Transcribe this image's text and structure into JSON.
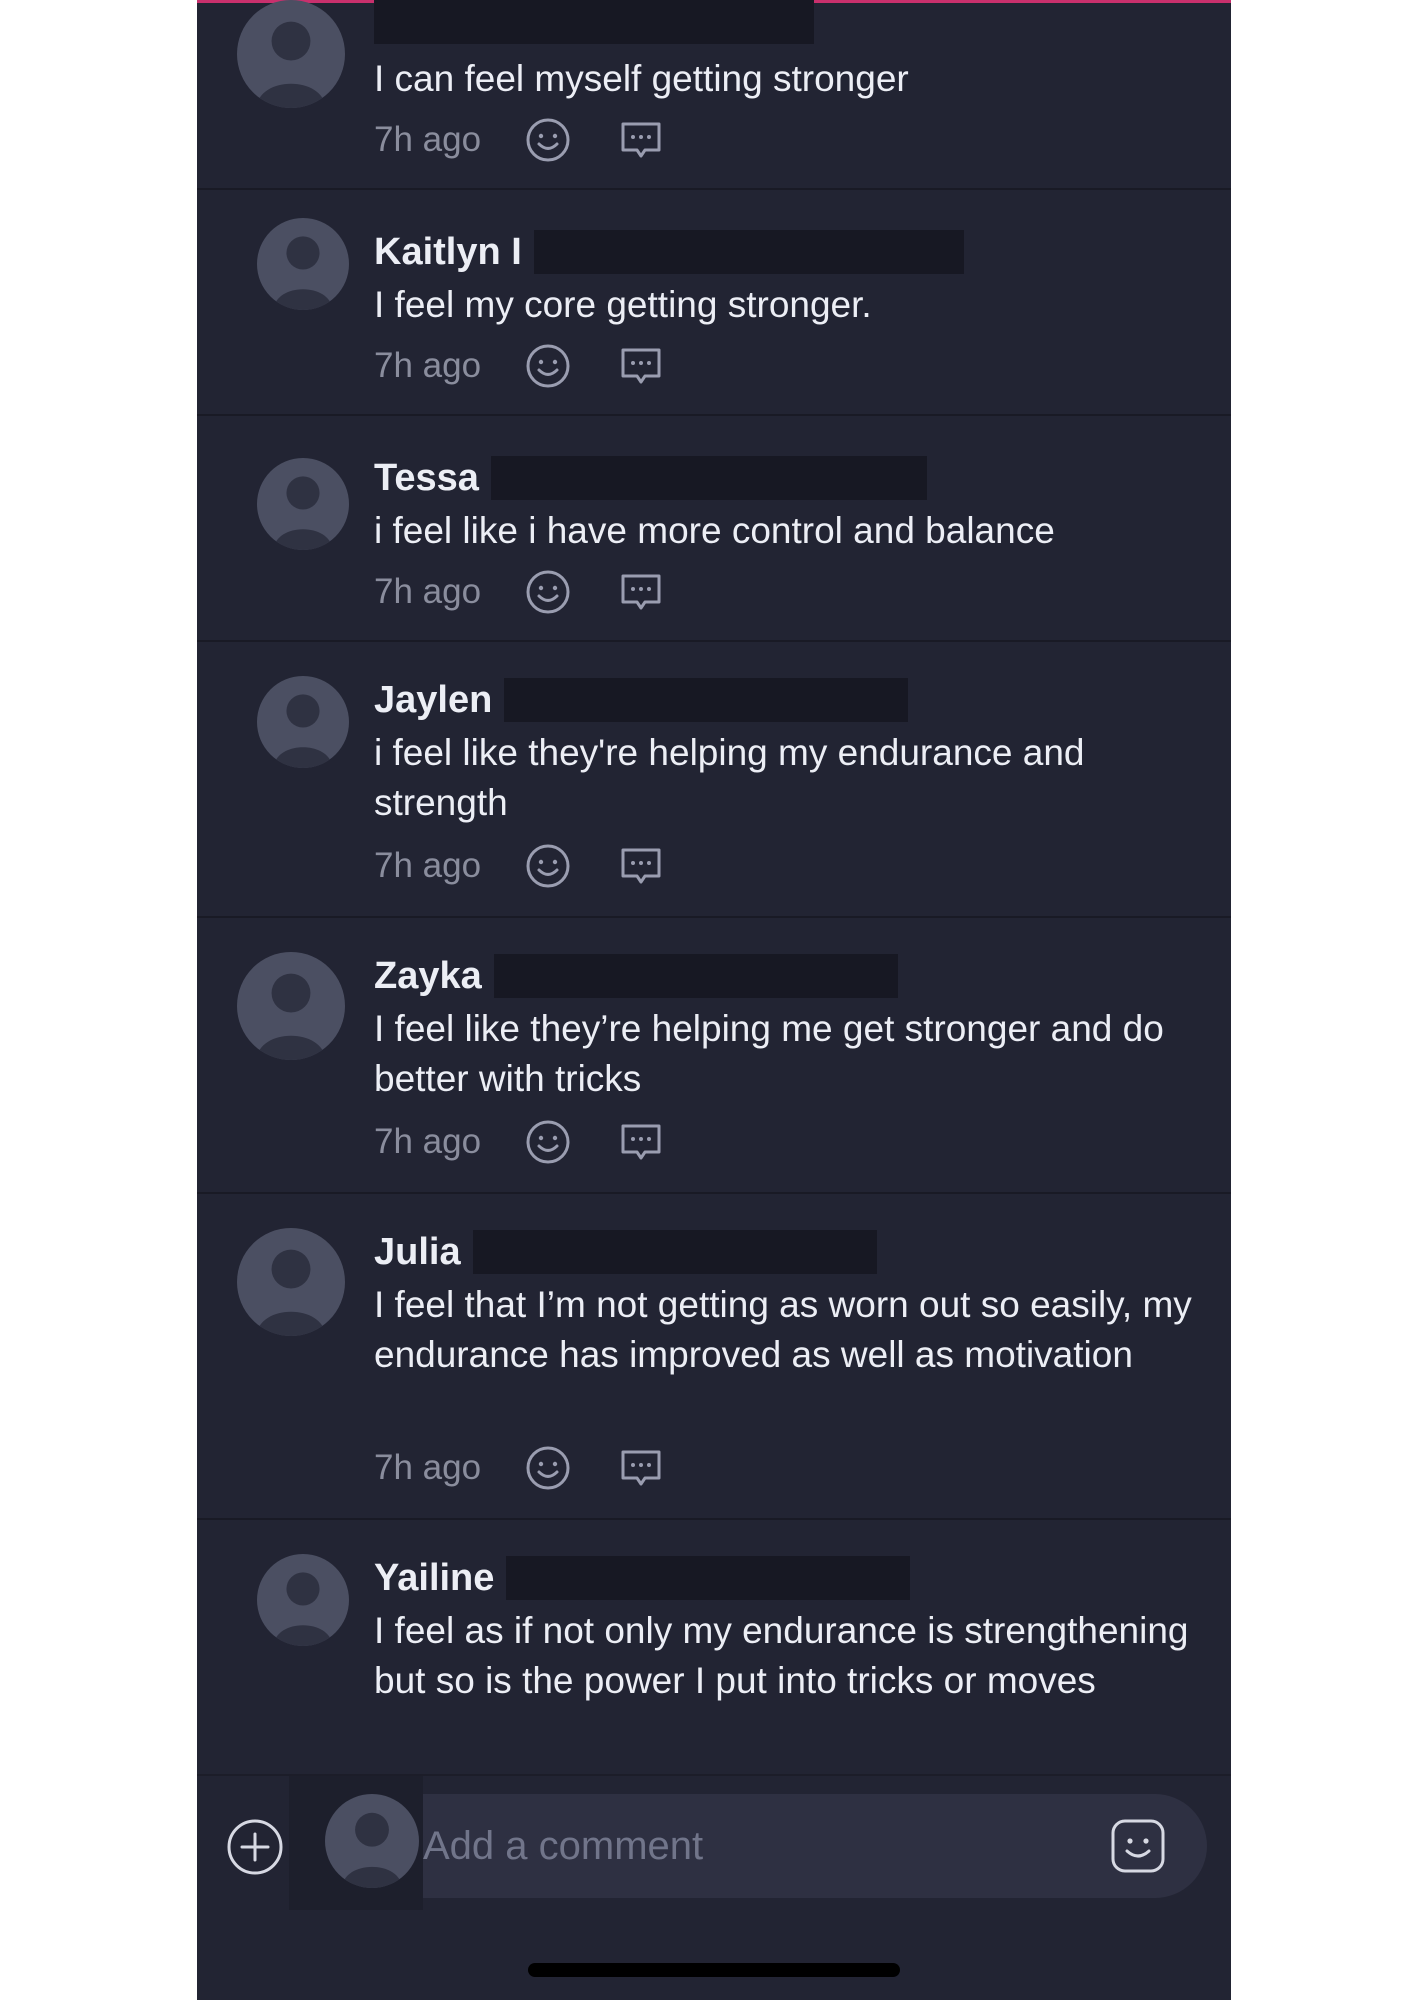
{
  "comments": [
    {
      "author": "",
      "text": "I can feel myself getting stronger",
      "time": "7h ago",
      "avatar_icon": "default-avatar-icon"
    },
    {
      "author": "Kaitlyn I",
      "text": "I feel my core getting stronger.",
      "time": "7h ago",
      "avatar_icon": "default-avatar-icon"
    },
    {
      "author": "Tessa",
      "text": "i feel like i have more control and balance",
      "time": "7h ago",
      "avatar_icon": "default-avatar-icon"
    },
    {
      "author": "Jaylen",
      "text": "i feel like they're helping my endurance and strength",
      "time": "7h ago",
      "avatar_icon": "default-avatar-icon"
    },
    {
      "author": "Zayka",
      "text": "I feel like they’re helping me get stronger and do better with tricks",
      "time": "7h ago",
      "avatar_icon": "default-avatar-icon"
    },
    {
      "author": "Julia",
      "text": "I feel that I’m not getting as worn out so easily, my endurance has improved as well as motivation",
      "time": "7h ago",
      "avatar_icon": "default-avatar-icon"
    },
    {
      "author": "Yailine",
      "text": "I feel as if not only my endurance is strengthening but so is the power I put into tricks or moves",
      "time": "",
      "avatar_icon": "default-avatar-icon"
    }
  ],
  "comment_actions": {
    "react_icon": "smiley-icon",
    "reply_icon": "speech-bubble-icon"
  },
  "composer": {
    "placeholder": "Add a comment",
    "add_icon": "plus-circle-icon",
    "emoji_icon": "emoji-icon"
  },
  "colors": {
    "background": "#222433",
    "accent": "#c9306d",
    "text": "#eceef5",
    "muted": "#8a8d9d"
  }
}
